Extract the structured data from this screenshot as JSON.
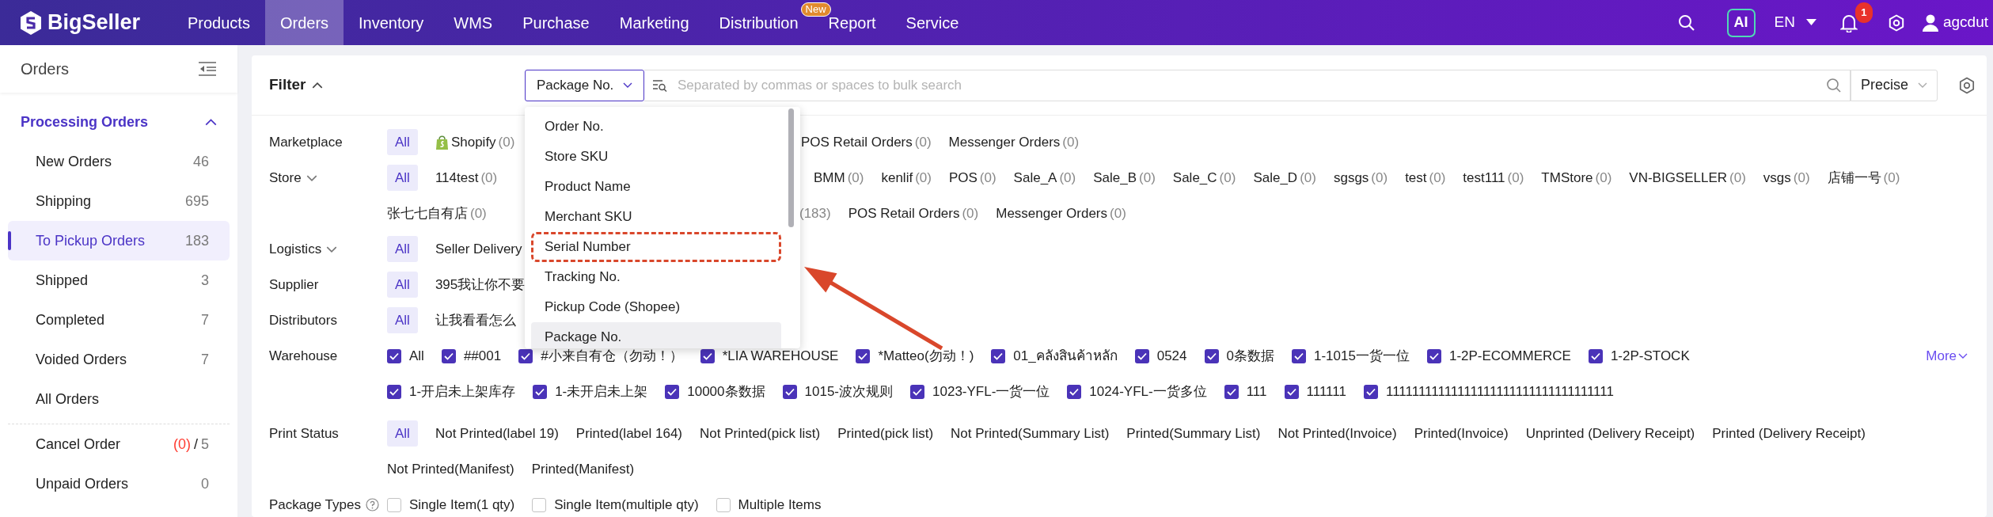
{
  "navbar": {
    "brand": "BigSeller",
    "menu": [
      {
        "label": "Products",
        "selected": false
      },
      {
        "label": "Orders",
        "selected": true
      },
      {
        "label": "Inventory",
        "selected": false
      },
      {
        "label": "WMS",
        "selected": false
      },
      {
        "label": "Purchase",
        "selected": false
      },
      {
        "label": "Marketing",
        "selected": false
      },
      {
        "label": "Distribution",
        "selected": false,
        "badge": "New"
      },
      {
        "label": "Report",
        "selected": false
      },
      {
        "label": "Service",
        "selected": false
      }
    ],
    "ai_label": "AI",
    "language": "EN",
    "notification_count": "1",
    "user": "agcdut"
  },
  "sidebar": {
    "title": "Orders",
    "sections": [
      {
        "label": "Processing Orders",
        "expanded": true,
        "items": [
          {
            "label": "New Orders",
            "count": "46",
            "selected": false
          },
          {
            "label": "Shipping",
            "count": "695",
            "selected": false
          },
          {
            "label": "To Pickup Orders",
            "count": "183",
            "selected": true
          },
          {
            "label": "Shipped",
            "count": "3",
            "selected": false
          },
          {
            "label": "Completed",
            "count": "7",
            "selected": false
          },
          {
            "label": "Voided Orders",
            "count": "7",
            "selected": false
          },
          {
            "label": "All Orders",
            "selected": false
          }
        ]
      }
    ],
    "extra_items": [
      {
        "label": "Cancel Order",
        "alert": "(0)",
        "separator": "/",
        "count": "5",
        "selected": false
      },
      {
        "label": "Unpaid Orders",
        "count": "0",
        "selected": false
      }
    ]
  },
  "filter": {
    "title": "Filter",
    "expanded": true,
    "search_type": {
      "value": "Package No.",
      "open": true,
      "options": [
        {
          "label": "Order No.",
          "selected": false,
          "annotated": false
        },
        {
          "label": "Store SKU",
          "selected": false,
          "annotated": false
        },
        {
          "label": "Product Name",
          "selected": false,
          "annotated": false
        },
        {
          "label": "Merchant SKU",
          "selected": false,
          "annotated": false
        },
        {
          "label": "Serial Number",
          "selected": false,
          "annotated": true
        },
        {
          "label": "Tracking No.",
          "selected": false,
          "annotated": false
        },
        {
          "label": "Pickup Code (Shopee)",
          "selected": false,
          "annotated": false
        },
        {
          "label": "Package No.",
          "selected": true,
          "annotated": false
        }
      ]
    },
    "search": {
      "placeholder": "Separated by commas or spaces to bulk search"
    },
    "match_mode": "Precise",
    "rows": [
      {
        "label": "Marketplace",
        "kind": "chips",
        "lines": [
          [
            {
              "text": "All",
              "selected": true
            },
            {
              "text": "Shopify",
              "count": "(0)",
              "has_logo": true,
              "selected": false
            },
            {
              "text": "POS Retail Orders",
              "count": "(0)",
              "selected": false
            },
            {
              "text": "Messenger Orders",
              "count": "(0)",
              "selected": false
            }
          ]
        ]
      },
      {
        "label": "Store",
        "expandable": true,
        "kind": "chips",
        "lines": [
          [
            {
              "text": "All",
              "selected": true
            },
            {
              "text": "114test",
              "count": "(0)",
              "selected": false
            },
            {
              "text": "BMM",
              "count": "(0)",
              "selected": false
            },
            {
              "text": "kenlif",
              "count": "(0)",
              "selected": false
            },
            {
              "text": "POS",
              "count": "(0)",
              "selected": false
            },
            {
              "text": "Sale_A",
              "count": "(0)",
              "selected": false
            },
            {
              "text": "Sale_B",
              "count": "(0)",
              "selected": false
            },
            {
              "text": "Sale_C",
              "count": "(0)",
              "selected": false
            },
            {
              "text": "Sale_D",
              "count": "(0)",
              "selected": false
            },
            {
              "text": "sgsgs",
              "count": "(0)",
              "selected": false
            },
            {
              "text": "test",
              "count": "(0)",
              "selected": false
            },
            {
              "text": "test111",
              "count": "(0)",
              "selected": false
            },
            {
              "text": "TMStore",
              "count": "(0)",
              "selected": false
            },
            {
              "text": "VN-BIGSELLER",
              "count": "(0)",
              "selected": false
            },
            {
              "text": "vsgs",
              "count": "(0)",
              "selected": false
            },
            {
              "text": "店铺一号",
              "count": "(0)",
              "selected": false
            }
          ],
          [
            {
              "text": "张七七自有店",
              "count": "(0)",
              "selected": false
            },
            {
              "count": "(183)",
              "selected": false
            },
            {
              "text": "POS Retail Orders",
              "count": "(0)",
              "selected": false
            },
            {
              "text": "Messenger Orders",
              "count": "(0)",
              "selected": false
            }
          ]
        ]
      },
      {
        "label": "Logistics",
        "expandable": true,
        "kind": "chips",
        "lines": [
          [
            {
              "text": "All",
              "selected": true
            },
            {
              "text": "Seller Delivery",
              "selected": false
            }
          ]
        ]
      },
      {
        "label": "Supplier",
        "kind": "chips",
        "lines": [
          [
            {
              "text": "All",
              "selected": true
            },
            {
              "text": "395我让你不要",
              "selected": false
            }
          ]
        ]
      },
      {
        "label": "Distributors",
        "kind": "chips",
        "lines": [
          [
            {
              "text": "All",
              "selected": true
            },
            {
              "text": "让我看看怎么",
              "selected": false
            }
          ]
        ]
      },
      {
        "label": "Warehouse",
        "kind": "checkboxes",
        "more": "More",
        "lines": [
          [
            {
              "text": "All",
              "checked": true
            },
            {
              "text": "##001",
              "checked": true
            },
            {
              "text": "#小来自有仓（勿动！）",
              "checked": true
            },
            {
              "text": "*LIA WAREHOUSE",
              "checked": true
            },
            {
              "text": "*Matteo(勿动！)",
              "checked": true
            },
            {
              "text": "01_คลังสินค้าหลัก",
              "checked": true
            },
            {
              "text": "0524",
              "checked": true
            },
            {
              "text": "0条数据",
              "checked": true
            },
            {
              "text": "1-1015一货一位",
              "checked": true
            },
            {
              "text": "1-2P-ECOMMERCE",
              "checked": true
            },
            {
              "text": "1-2P-STOCK",
              "checked": true
            }
          ],
          [
            {
              "text": "1-开启未上架库存",
              "checked": true
            },
            {
              "text": "1-未开启未上架",
              "checked": true
            },
            {
              "text": "10000条数据",
              "checked": true
            },
            {
              "text": "1015-波次规则",
              "checked": true
            },
            {
              "text": "1023-YFL-一货一位",
              "checked": true
            },
            {
              "text": "1024-YFL-一货多位",
              "checked": true
            },
            {
              "text": "111",
              "checked": true
            },
            {
              "text": "111111",
              "checked": true
            },
            {
              "text": "11111111111111111111111111111111111",
              "checked": true
            }
          ]
        ]
      },
      {
        "label": "Print Status",
        "kind": "chips",
        "lines": [
          [
            {
              "text": "All",
              "selected": true
            },
            {
              "text": "Not Printed(label 19)",
              "selected": false
            },
            {
              "text": "Printed(label 164)",
              "selected": false
            },
            {
              "text": "Not Printed(pick list)",
              "selected": false
            },
            {
              "text": "Printed(pick list)",
              "selected": false
            },
            {
              "text": "Not Printed(Summary List)",
              "selected": false
            },
            {
              "text": "Printed(Summary List)",
              "selected": false
            },
            {
              "text": "Not Printed(Invoice)",
              "selected": false
            },
            {
              "text": "Printed(Invoice)",
              "selected": false
            },
            {
              "text": "Unprinted (Delivery Receipt)",
              "selected": false
            },
            {
              "text": "Printed (Delivery Receipt)",
              "selected": false
            }
          ],
          [
            {
              "text": "Not Printed(Manifest)",
              "selected": false
            },
            {
              "text": "Printed(Manifest)",
              "selected": false
            }
          ]
        ]
      },
      {
        "label": "Package Types",
        "help": true,
        "kind": "checkboxes",
        "lines": [
          [
            {
              "text": "Single Item(1 qty)",
              "checked": false
            },
            {
              "text": "Single Item(multiple qty)",
              "checked": false
            },
            {
              "text": "Multiple Items",
              "checked": false
            }
          ]
        ]
      }
    ]
  }
}
